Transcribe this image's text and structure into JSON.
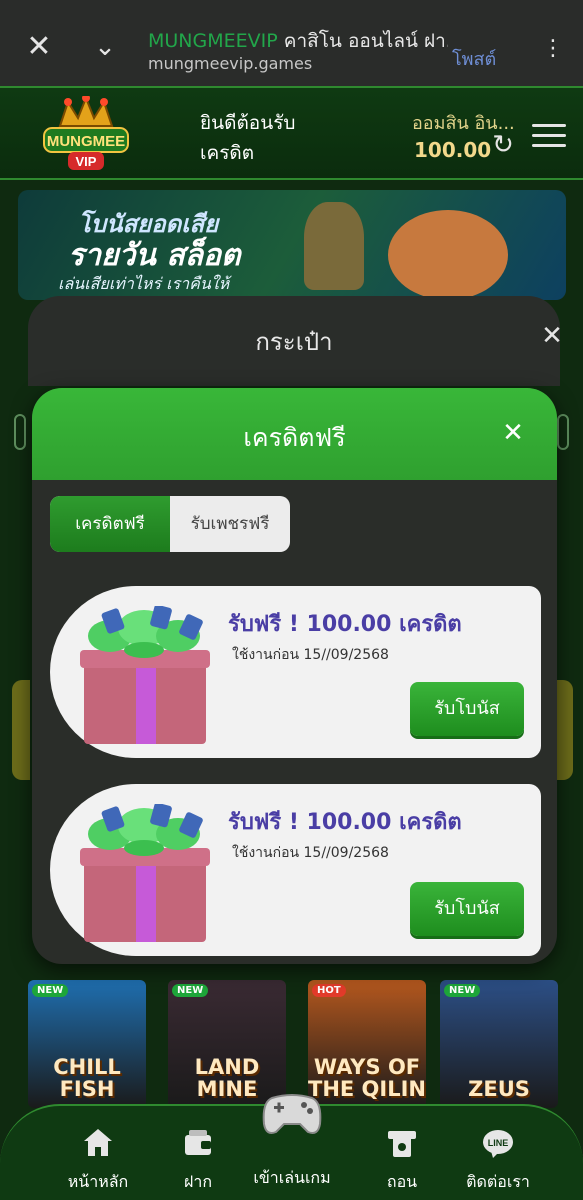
{
  "browser": {
    "title_brand": "MUNGMEEVIP",
    "title_rest": " คาสิโน ออนไลน์ ฝา...",
    "url": "mungmeevip.games",
    "post_label": "โพสต์"
  },
  "header": {
    "logo_text": "MUNGMEE VIP",
    "welcome": "ยินดีต้อนรับ",
    "credit_label": "เครดิต",
    "user": "ออมสิน อิน...",
    "balance": "100.00"
  },
  "banner": {
    "line1": "โบนัสยอดเสีย",
    "line2": "รายวัน สล็อต",
    "line3": "เล่นเสียเท่าไหร่ เราคืนให้"
  },
  "wallet_modal": {
    "title": "กระเป๋า"
  },
  "credit_modal": {
    "title": "เครดิตฟรี",
    "tabs": [
      "เครดิตฟรี",
      "รับเพชรฟรี"
    ],
    "offers": [
      {
        "title": "รับฟรี ! 100.00 เครดิต",
        "expiry": "ใช้งานก่อน 15//09/2568",
        "button": "รับโบนัส"
      },
      {
        "title": "รับฟรี ! 100.00 เครดิต",
        "expiry": "ใช้งานก่อน 15//09/2568",
        "button": "รับโบนัส"
      }
    ]
  },
  "games": [
    {
      "tag": "NEW",
      "name": "CHILL FISH",
      "color": "#1f6fb0"
    },
    {
      "tag": "NEW",
      "name": "LAND MINE",
      "color": "#3a2a33"
    },
    {
      "tag": "HOT",
      "name": "WAYS OF THE QILIN",
      "color": "#b5581e"
    },
    {
      "tag": "NEW",
      "name": "ZEUS",
      "color": "#2c4f86"
    }
  ],
  "bottom_nav": [
    {
      "label": "หน้าหลัก",
      "icon": "home-icon"
    },
    {
      "label": "ฝาก",
      "icon": "wallet-icon"
    },
    {
      "label": "เข้าเล่นเกม",
      "icon": "gamepad-icon"
    },
    {
      "label": "ถอน",
      "icon": "withdraw-icon"
    },
    {
      "label": "ติดต่อเรา",
      "icon": "line-icon"
    }
  ],
  "colors": {
    "brand_green": "#2fa02f",
    "accent_gold": "#f2d88b",
    "offer_title": "#4a3ea5"
  }
}
